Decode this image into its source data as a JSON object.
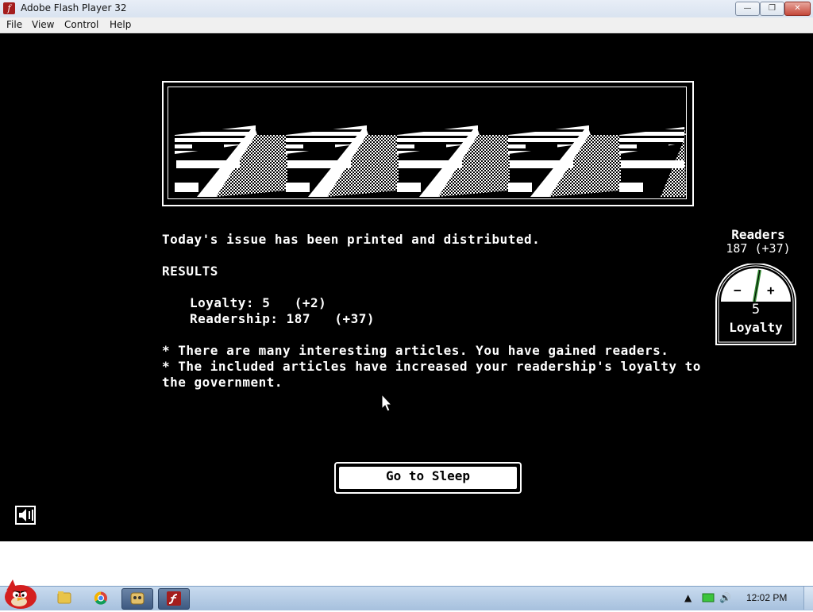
{
  "window": {
    "title": "Adobe Flash Player 32",
    "icon": "flash-icon",
    "controls": [
      "minimize-icon",
      "restore-icon",
      "close-icon"
    ]
  },
  "menubar": {
    "items": [
      "File",
      "View",
      "Control",
      "Help"
    ]
  },
  "game": {
    "status_line": "Today's issue has been printed and distributed.",
    "results_heading": "RESULTS",
    "loyalty_line": "Loyalty: 5   (+2)",
    "readership_line": "Readership: 187   (+37)",
    "note_1": "* There are many interesting articles. You have gained readers.",
    "note_2_line1": "* The included articles have increased your readership's loyalty to",
    "note_2_line2": "the government.",
    "readers_title": "Readers",
    "readers_value": "187 (+37)",
    "gauge_minus": "−",
    "gauge_plus": "+",
    "gauge_value": "5",
    "gauge_label": "Loyalty",
    "sleep_button": "Go to Sleep",
    "sound_icon": "speaker-icon"
  },
  "taskbar": {
    "clock": "12:02 PM",
    "pinned": [
      "angry-birds-start-icon",
      "explorer-folder-icon",
      "chrome-icon",
      "game-icon",
      "flash-player-icon"
    ],
    "tray_icons": [
      "tray-arrow-icon",
      "network-icon",
      "volume-icon"
    ]
  }
}
